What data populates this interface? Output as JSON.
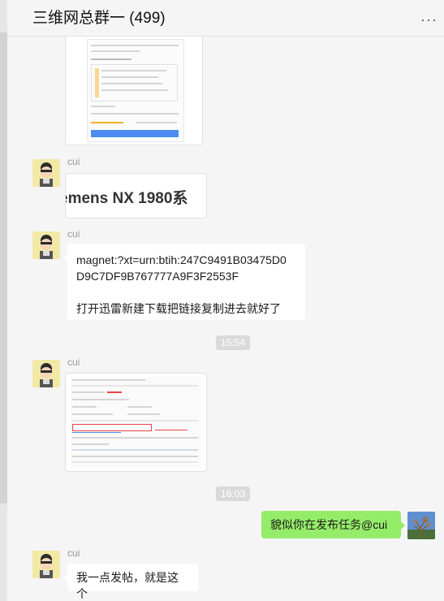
{
  "header": {
    "title": "三维网总群一 (499)",
    "more_icon": "···"
  },
  "messages": [
    {
      "type": "image",
      "sender": "",
      "description": "download dialog screenshot"
    },
    {
      "type": "image",
      "sender": "cui",
      "image_text": "emens NX 1980系"
    },
    {
      "type": "text",
      "sender": "cui",
      "lines": [
        "magnet:?xt=urn:btih:247C9491B03475D0",
        "D9C7DF9B767777A9F3F2553F",
        "",
        "打开迅雷新建下载把链接复制进去就好了"
      ]
    },
    {
      "type": "time",
      "text": "15:54"
    },
    {
      "type": "image",
      "sender": "cui"
    },
    {
      "type": "time",
      "text": "16:03"
    },
    {
      "type": "text",
      "sender": "me",
      "lines": [
        "貌似你在发布任务@cui"
      ]
    },
    {
      "type": "text",
      "sender": "cui",
      "lines": [
        "我一点发帖，就是这个"
      ]
    }
  ],
  "colors": {
    "my_bubble": "#95ec69",
    "other_bubble": "#ffffff",
    "background": "#f5f5f5"
  }
}
